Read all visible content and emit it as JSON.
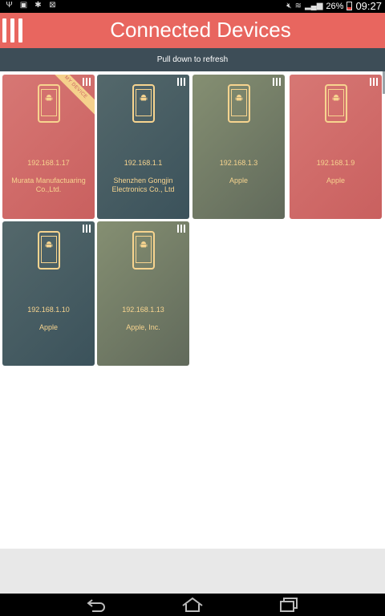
{
  "status_bar": {
    "battery": "26%",
    "time": "09:27",
    "icons": [
      "usb-icon",
      "image-icon",
      "android-debug-icon",
      "exchange-icon",
      "mute-icon",
      "wifi-icon",
      "signal-icon",
      "battery-icon"
    ]
  },
  "app_bar": {
    "title": "Connected Devices",
    "menu_icon": "menu-icon",
    "background": "#e8665f"
  },
  "refresh_bar": {
    "text": "Pull down to refresh",
    "background": "#3d4d57"
  },
  "devices": [
    {
      "ip": "192.168.1.17",
      "vendor": "Murata Manufactuaring Co.,Ltd.",
      "color": "#d06c6a",
      "ribbon": "MY DEVICE"
    },
    {
      "ip": "192.168.1.1",
      "vendor": "Shenzhen Gongjin Electronics Co., Ltd",
      "color": "#465b61"
    },
    {
      "ip": "192.168.1.3",
      "vendor": "Apple",
      "color": "#747d67"
    },
    {
      "ip": "192.168.1.9",
      "vendor": "Apple",
      "color": "#d06c6a"
    },
    {
      "ip": "192.168.1.10",
      "vendor": "Apple",
      "color": "#465b61"
    },
    {
      "ip": "192.168.1.13",
      "vendor": "Apple, Inc.",
      "color": "#747d67"
    }
  ],
  "colors": {
    "accent_text": "#f7d48f",
    "card_red": "#d06c6a",
    "card_teal": "#465b61",
    "card_olive": "#747d67"
  },
  "nav_bar": {
    "icons": [
      "back-icon",
      "home-icon",
      "recent-apps-icon"
    ]
  }
}
